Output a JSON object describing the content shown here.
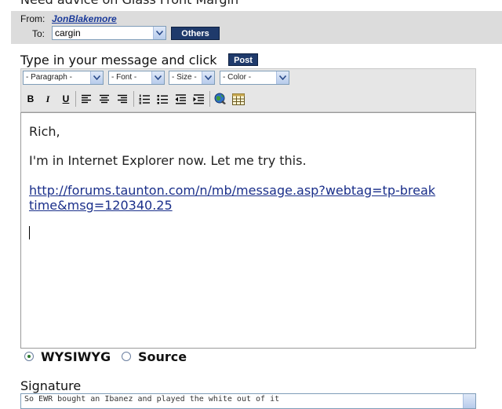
{
  "header": {
    "partial_title": "Need advice on Glass Front Margin",
    "from_label": "From:",
    "from_name": "JonBlakemore",
    "to_label": "To:",
    "to_value": "cargin",
    "others_label": "Others"
  },
  "compose": {
    "prompt": "Type in your message and click",
    "post_label": "Post"
  },
  "toolbar": {
    "paragraph": "- Paragraph -",
    "font": "- Font -",
    "size": "- Size -",
    "color": "- Color -",
    "bold": "B",
    "italic": "I",
    "underline": "U"
  },
  "editor": {
    "line1": "Rich,",
    "line2": "I'm in Internet Explorer now.  Let me try this.",
    "link": "http://forums.taunton.com/n/mb/message.asp?webtag=tp-breaktime&msg=120340.25"
  },
  "mode": {
    "wysiwyg": "WYSIWYG",
    "source": "Source",
    "selected": "WYSIWYG"
  },
  "signature": {
    "label": "Signature",
    "value": "So EWR bought an Ibanez and played the white out of it"
  }
}
